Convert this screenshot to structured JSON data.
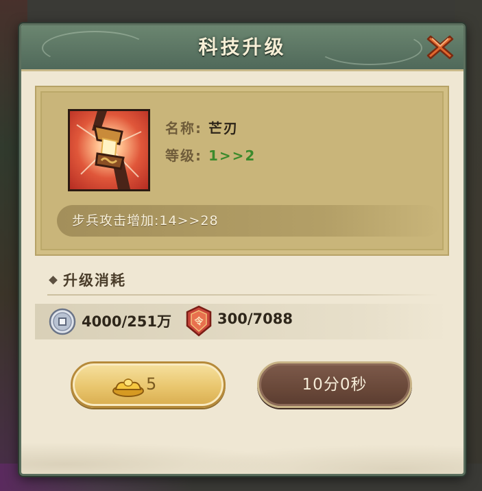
{
  "dialog": {
    "title": "科技升级",
    "close_icon": "close-x-icon"
  },
  "tech": {
    "icon": "blade-relic-icon",
    "name_label": "名称:",
    "name_value": "芒刃",
    "level_label": "等级:",
    "level_value": "1>>2",
    "bonus_text": "步兵攻击增加:14>>28"
  },
  "cost": {
    "section_title": "升级消耗",
    "items": [
      {
        "icon": "silver-coin-icon",
        "text": "4000/251万"
      },
      {
        "icon": "red-token-icon",
        "text": "300/7088"
      }
    ]
  },
  "actions": {
    "gold_button": {
      "icon": "gold-ingot-icon",
      "label": "5"
    },
    "timer_button": {
      "label": "10分0秒"
    }
  },
  "colors": {
    "header": "#5a7563",
    "card": "#c9b57a",
    "level_green": "#3c8a2c",
    "gold_button": "#e9c66e",
    "brown_button": "#694839"
  }
}
